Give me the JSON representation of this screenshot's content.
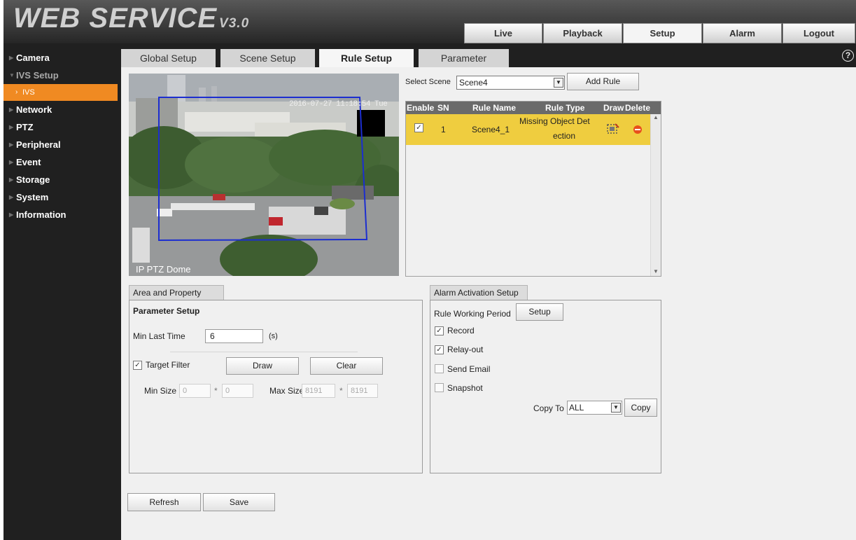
{
  "app": {
    "logo_text": "WEB SERVICE",
    "logo_version": "V3.0"
  },
  "top_nav": [
    {
      "label": "Live",
      "active": false
    },
    {
      "label": "Playback",
      "active": false
    },
    {
      "label": "Setup",
      "active": true
    },
    {
      "label": "Alarm",
      "active": false
    },
    {
      "label": "Logout",
      "active": false
    }
  ],
  "sidebar": {
    "items": [
      {
        "label": "Camera",
        "state": "collapsed"
      },
      {
        "label": "IVS Setup",
        "state": "expanded"
      },
      {
        "label": "IVS",
        "state": "selected"
      },
      {
        "label": "Network",
        "state": "collapsed"
      },
      {
        "label": "PTZ",
        "state": "collapsed"
      },
      {
        "label": "Peripheral",
        "state": "collapsed"
      },
      {
        "label": "Event",
        "state": "collapsed"
      },
      {
        "label": "Storage",
        "state": "collapsed"
      },
      {
        "label": "System",
        "state": "collapsed"
      },
      {
        "label": "Information",
        "state": "collapsed"
      }
    ]
  },
  "tabs": [
    {
      "label": "Global Setup",
      "active": false
    },
    {
      "label": "Scene Setup",
      "active": false
    },
    {
      "label": "Rule Setup",
      "active": true
    },
    {
      "label": "Parameter",
      "active": false
    }
  ],
  "help_label": "?",
  "video": {
    "timestamp": "2016-07-27 11:18:54 Tue",
    "channel_name": "IP PTZ Dome"
  },
  "scene": {
    "label": "Select Scene",
    "value": "Scene4",
    "add_rule_label": "Add Rule"
  },
  "rule_table": {
    "headers": [
      "Enable",
      "SN",
      "Rule Name",
      "Rule Type",
      "Draw",
      "Delete"
    ],
    "rows": [
      {
        "enabled": true,
        "sn": "1",
        "name": "Scene4_1",
        "type_line1": "Missing Object Det",
        "type_line2": "ection"
      }
    ]
  },
  "area": {
    "tab_label": "Area and Property Setup",
    "heading": "Parameter Setup",
    "min_last_time_label": "Min Last Time",
    "min_last_time_value": "6",
    "min_last_time_unit": "(s)",
    "target_filter_label": "Target Filter",
    "target_filter_checked": true,
    "draw_label": "Draw",
    "clear_label": "Clear",
    "min_size_label": "Min Size",
    "min_w": "0",
    "min_h": "0",
    "times": "*",
    "max_size_label": "Max Size",
    "max_w": "8191",
    "max_h": "8191"
  },
  "alarm": {
    "tab_label": "Alarm Activation Setup",
    "period_label": "Rule Working Period",
    "setup_label": "Setup",
    "options": [
      {
        "label": "Record",
        "checked": true
      },
      {
        "label": "Relay-out",
        "checked": true
      },
      {
        "label": "Send Email",
        "checked": false
      },
      {
        "label": "Snapshot",
        "checked": false
      }
    ],
    "copy_to_label": "Copy To",
    "copy_to_value": "ALL",
    "copy_label": "Copy"
  },
  "footer": {
    "refresh_label": "Refresh",
    "save_label": "Save"
  },
  "colors": {
    "accent": "#f08a22",
    "row_highlight": "#efcd3f",
    "sidebar_bg": "#202020",
    "roi": "#1c2ed0"
  }
}
